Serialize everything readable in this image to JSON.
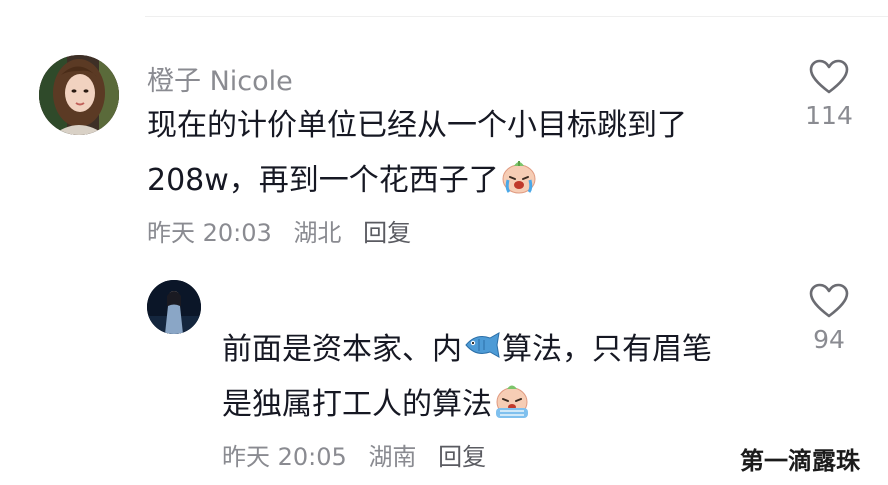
{
  "comments": [
    {
      "username": "橙子 Nicole",
      "line1": "现在的计价单位已经从一个小目标跳到了",
      "line2": "208w，再到一个花西子了",
      "time": "昨天 20:03",
      "location": "湖北",
      "reply_label": "回复",
      "likes": "114"
    },
    {
      "line1_a": "前面是资本家、内",
      "line1_b": "算法，只有眉笔",
      "line2": "是独属打工人的算法",
      "time": "昨天 20:05",
      "location": "湖南",
      "reply_label": "回复",
      "likes": "94"
    }
  ],
  "watermark": "第一滴露珠",
  "colors": {
    "text": "#161823",
    "secondary": "#8a8b91",
    "background": "#ffffff"
  }
}
